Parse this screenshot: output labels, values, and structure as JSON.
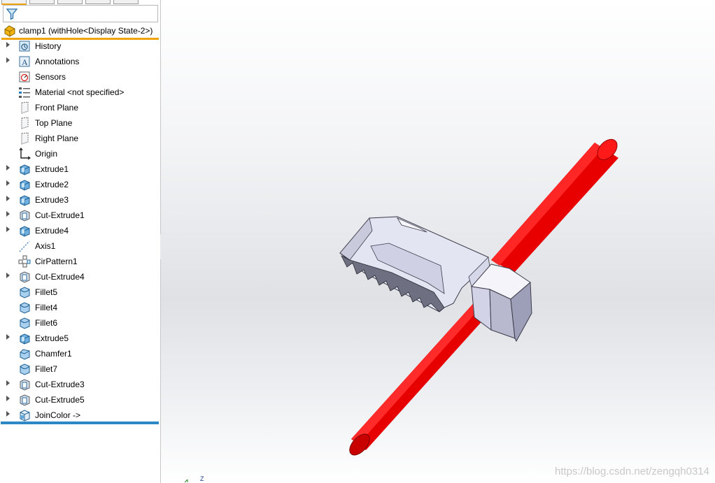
{
  "tree": {
    "root_label": "clamp1  (withHole<Display State-2>)",
    "items": [
      {
        "label": "History",
        "icon": "history-icon",
        "expandable": true
      },
      {
        "label": "Annotations",
        "icon": "annotations-icon",
        "expandable": true
      },
      {
        "label": "Sensors",
        "icon": "sensors-icon",
        "expandable": false
      },
      {
        "label": "Material <not specified>",
        "icon": "material-icon",
        "expandable": false
      },
      {
        "label": "Front Plane",
        "icon": "plane-icon",
        "expandable": false
      },
      {
        "label": "Top Plane",
        "icon": "plane-icon",
        "expandable": false
      },
      {
        "label": "Right Plane",
        "icon": "plane-icon",
        "expandable": false
      },
      {
        "label": "Origin",
        "icon": "origin-icon",
        "expandable": false
      },
      {
        "label": "Extrude1",
        "icon": "extrude-icon",
        "expandable": true
      },
      {
        "label": "Extrude2",
        "icon": "extrude-icon",
        "expandable": true
      },
      {
        "label": "Extrude3",
        "icon": "extrude-icon",
        "expandable": true
      },
      {
        "label": "Cut-Extrude1",
        "icon": "cut-extrude-icon",
        "expandable": true
      },
      {
        "label": "Extrude4",
        "icon": "extrude-icon",
        "expandable": true
      },
      {
        "label": "Axis1",
        "icon": "axis-icon",
        "expandable": false
      },
      {
        "label": "CirPattern1",
        "icon": "cirpattern-icon",
        "expandable": false
      },
      {
        "label": "Cut-Extrude4",
        "icon": "cut-extrude-icon",
        "expandable": true
      },
      {
        "label": "Fillet5",
        "icon": "fillet-icon",
        "expandable": false
      },
      {
        "label": "Fillet4",
        "icon": "fillet-icon",
        "expandable": false
      },
      {
        "label": "Fillet6",
        "icon": "fillet-icon",
        "expandable": false
      },
      {
        "label": "Extrude5",
        "icon": "extrude-icon",
        "expandable": true
      },
      {
        "label": "Chamfer1",
        "icon": "chamfer-icon",
        "expandable": false
      },
      {
        "label": "Fillet7",
        "icon": "fillet-icon",
        "expandable": false
      },
      {
        "label": "Cut-Extrude3",
        "icon": "cut-extrude-icon",
        "expandable": true
      },
      {
        "label": "Cut-Extrude5",
        "icon": "cut-extrude-icon",
        "expandable": true
      },
      {
        "label": "JoinColor ->",
        "icon": "joincolor-icon",
        "expandable": true
      }
    ]
  },
  "viewport": {
    "watermark": "https://blog.csdn.net/zengqh0314",
    "triad_label": "Z"
  },
  "colors": {
    "rod": "#ee0000",
    "part": "#dadbea",
    "rollback_bar": "#2f88c6",
    "root_underline": "#f0a30a"
  }
}
